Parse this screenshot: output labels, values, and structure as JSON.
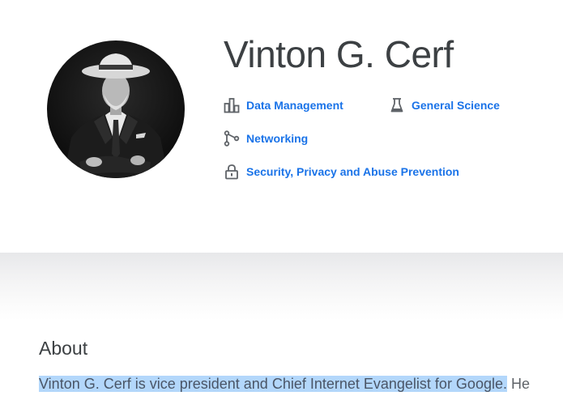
{
  "profile": {
    "name": "Vinton G. Cerf",
    "research_areas": [
      {
        "label": "Data Management",
        "icon": "bar-chart-icon"
      },
      {
        "label": "General Science",
        "icon": "flask-icon"
      },
      {
        "label": "Networking",
        "icon": "network-nodes-icon"
      },
      {
        "label": "Security, Privacy and Abuse Prevention",
        "icon": "lock-icon"
      }
    ]
  },
  "about": {
    "heading": "About",
    "selected_text": "Vinton G. Cerf is vice president and Chief Internet Evangelist for Google.",
    "rest_text": " He"
  },
  "colors": {
    "link": "#1a73e8",
    "heading": "#3c4043",
    "icon": "#5f6368",
    "selection": "#b3d7fb"
  }
}
